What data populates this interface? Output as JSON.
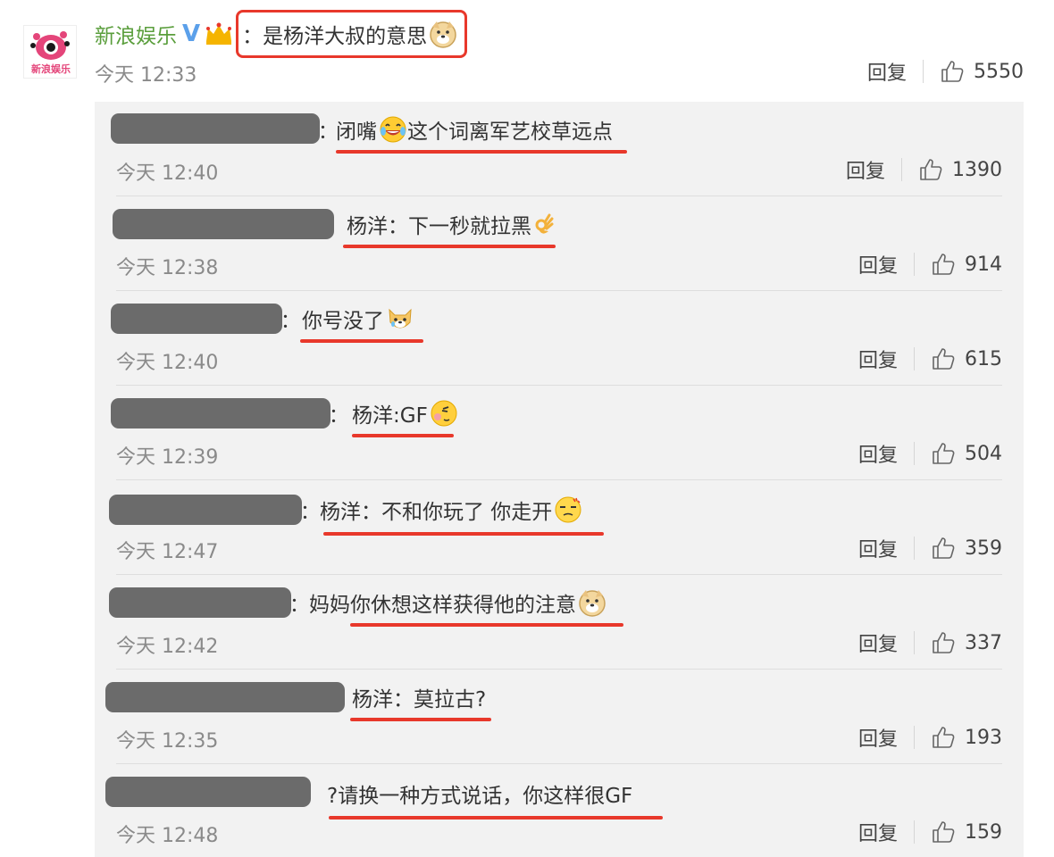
{
  "top_comment": {
    "author": "新浪娱乐",
    "verified_mark": "V",
    "text": "：是杨洋大叔的意思",
    "time": "今天 12:33",
    "reply_label": "回复",
    "likes": "5550",
    "avatar_label": "新浪娱乐",
    "emoji": "doge-icon"
  },
  "replies": [
    {
      "text": "闭嘴",
      "text2": "这个词离军艺校草远点",
      "emoji": "laugh-cry-icon",
      "time": "今天 12:40",
      "reply_label": "回复",
      "likes": "1390"
    },
    {
      "text": "杨洋：下一秒就拉黑",
      "emoji": "ok-hand-icon",
      "time": "今天 12:38",
      "reply_label": "回复",
      "likes": "914"
    },
    {
      "text": "你号没了",
      "emoji": "cat-doge-icon",
      "time": "今天 12:40",
      "reply_label": "回复",
      "likes": "615"
    },
    {
      "text": "杨洋:GF",
      "emoji": "shy-face-icon",
      "time": "今天 12:39",
      "reply_label": "回复",
      "likes": "504"
    },
    {
      "text": "杨洋：不和你玩了 你走开",
      "emoji": "annoyed-face-icon",
      "time": "今天 12:47",
      "reply_label": "回复",
      "likes": "359"
    },
    {
      "text": "妈妈你休想这样获得他的注意",
      "emoji": "doge-icon",
      "time": "今天 12:42",
      "reply_label": "回复",
      "likes": "337"
    },
    {
      "text": "杨洋：莫拉古?",
      "time": "今天 12:35",
      "reply_label": "回复",
      "likes": "193"
    },
    {
      "text": "?请换一种方式说话，你这样很GF",
      "time": "今天 12:48",
      "reply_label": "回复",
      "likes": "159"
    }
  ],
  "colors": {
    "highlight_red": "#e8382b",
    "author_green": "#5a9e3c",
    "verified_blue": "#5ba0ea",
    "panel_bg": "#f2f2f2",
    "redaction_gray": "#6b6b6b"
  }
}
